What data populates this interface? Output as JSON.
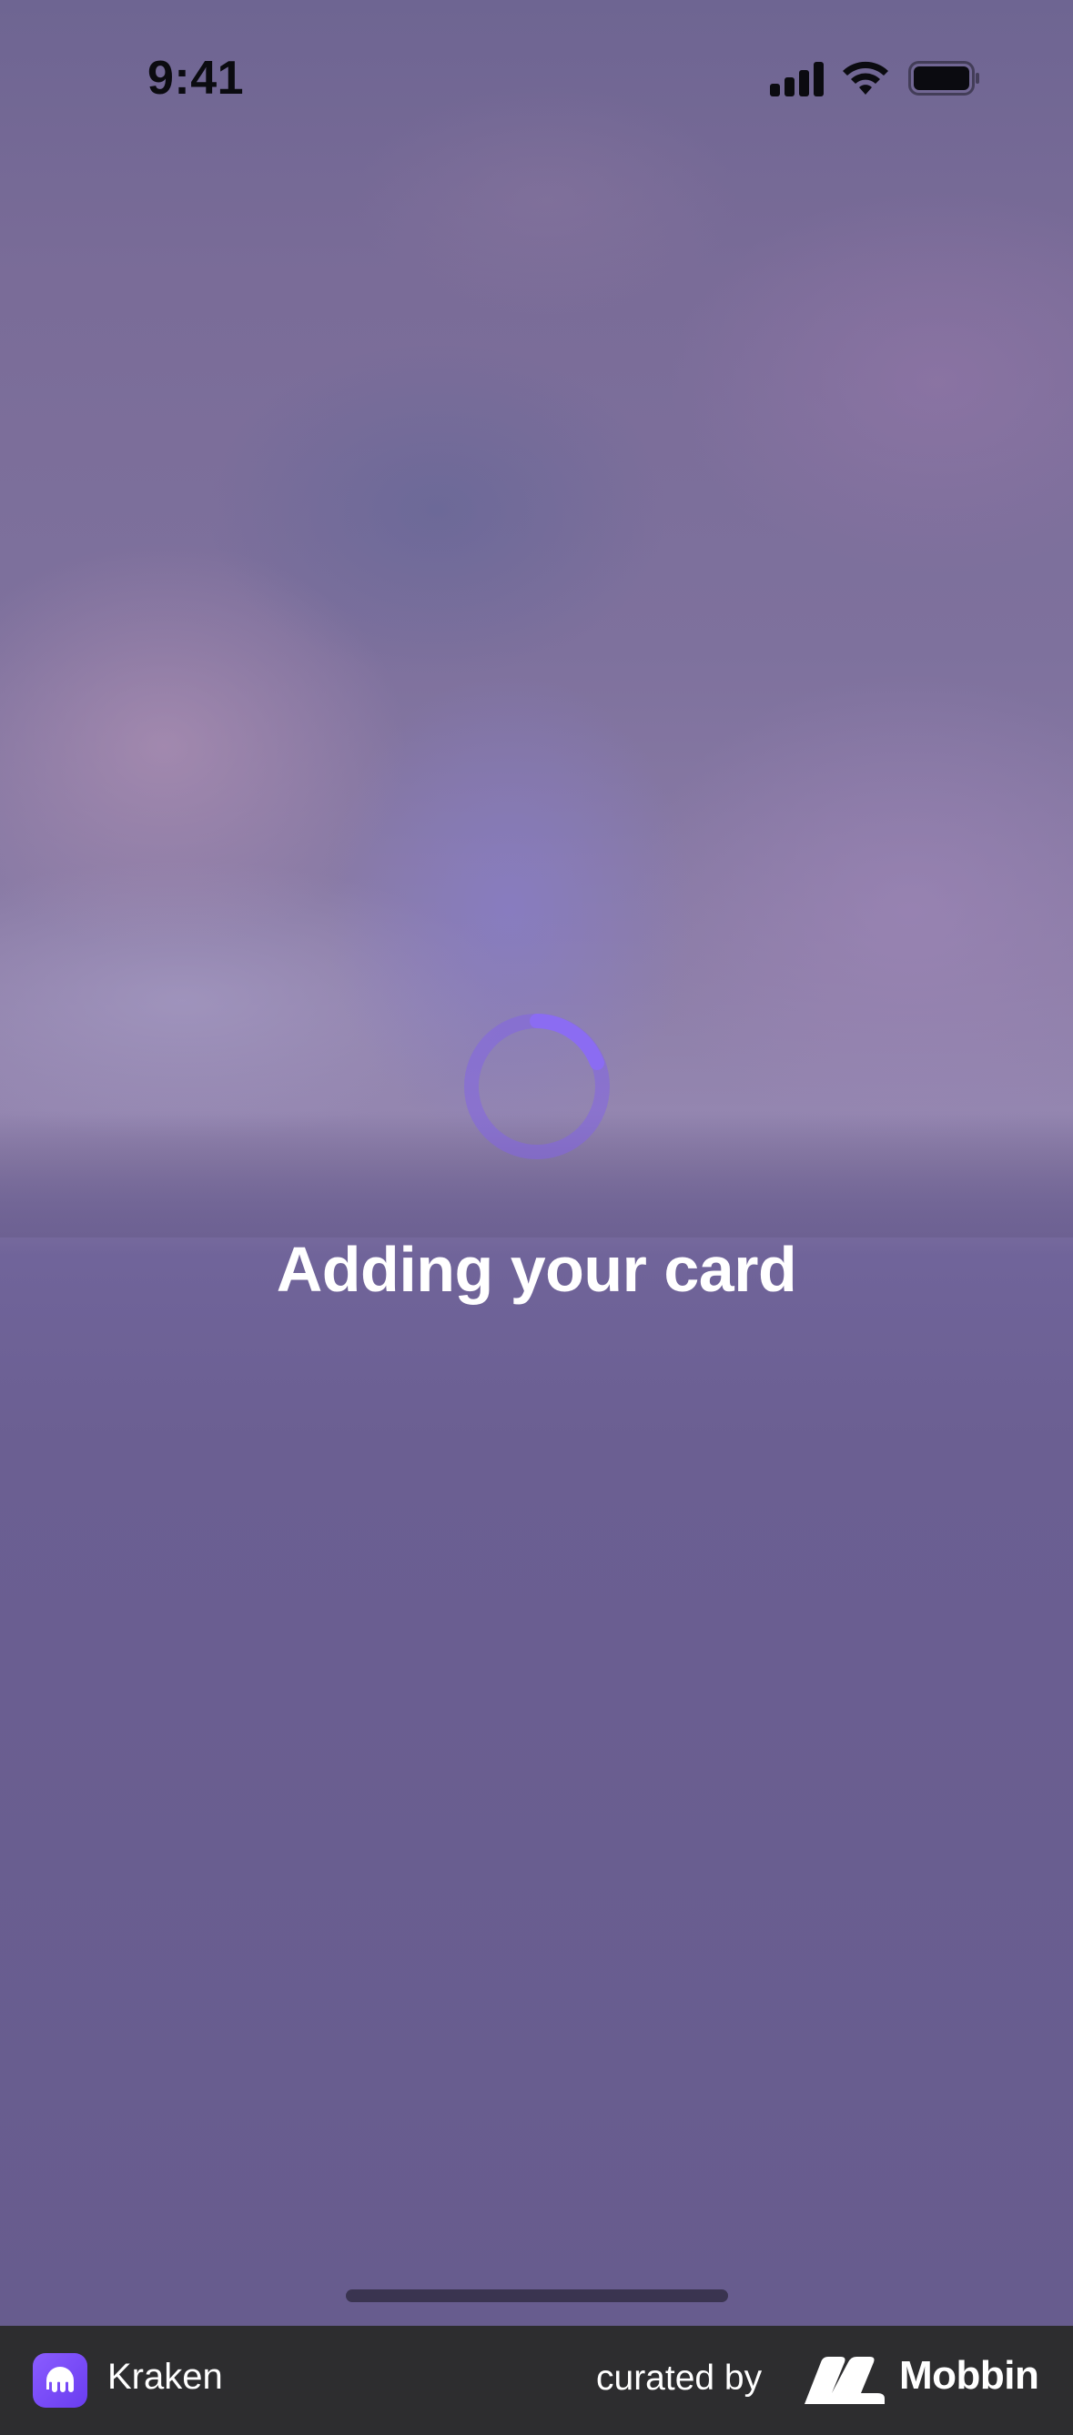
{
  "status_bar": {
    "time": "9:41",
    "icons": [
      "cellular-signal-icon",
      "wifi-icon",
      "battery-icon"
    ]
  },
  "main": {
    "title": "Adding your card",
    "spinner_icon": "loading-spinner-icon",
    "accent_color": "#8b6cf2"
  },
  "footer": {
    "app_icon": "kraken-logo-icon",
    "app_name": "Kraken",
    "curated_label": "curated by",
    "brand_logo": "mobbin-logo-icon",
    "brand_name": "Mobbin"
  }
}
